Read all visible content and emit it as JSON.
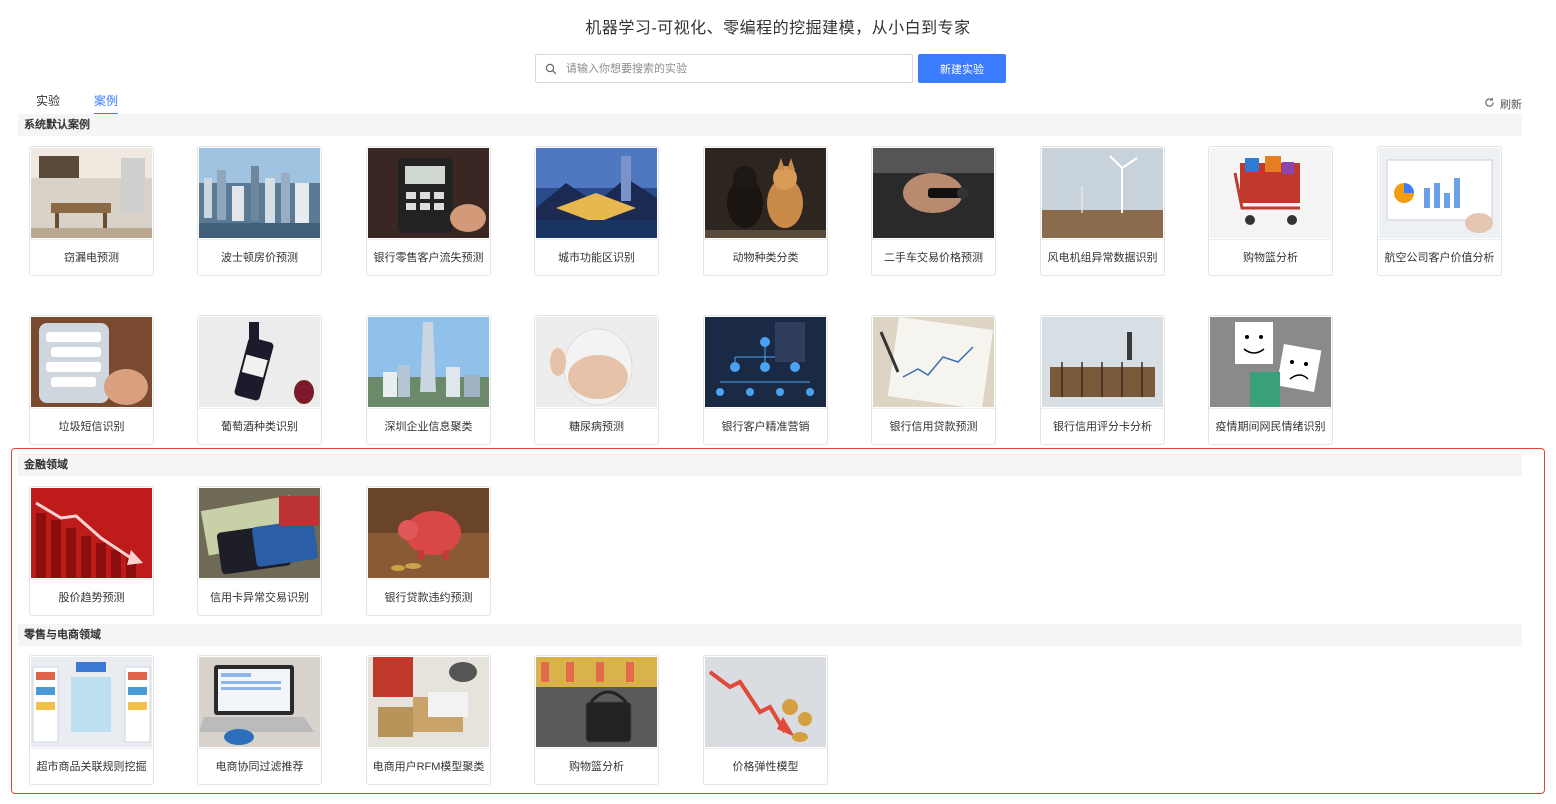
{
  "header": {
    "title": "机器学习-可视化、零编程的挖掘建模，从小白到专家"
  },
  "search": {
    "placeholder": "请输入你想要搜索的实验",
    "value": ""
  },
  "toolbar": {
    "new_button": "新建实验",
    "refresh_label": "刷新"
  },
  "tabs": [
    {
      "label": "实验",
      "active": false
    },
    {
      "label": "案例",
      "active": true
    }
  ],
  "sections": [
    {
      "title": "系统默认案例",
      "cards": [
        {
          "label": "窃漏电预测",
          "icon": "kitchen-photo"
        },
        {
          "label": "波士顿房价预测",
          "icon": "city-skyline-photo"
        },
        {
          "label": "银行零售客户流失预测",
          "icon": "pos-terminal-photo"
        },
        {
          "label": "城市功能区识别",
          "icon": "city-night-photo"
        },
        {
          "label": "动物种类分类",
          "icon": "dogs-photo"
        },
        {
          "label": "二手车交易价格预测",
          "icon": "car-key-photo"
        },
        {
          "label": "风电机组异常数据识别",
          "icon": "wind-turbine-photo"
        },
        {
          "label": "购物篮分析",
          "icon": "shopping-cart-photo"
        },
        {
          "label": "航空公司客户价值分析",
          "icon": "dashboard-photo"
        },
        {
          "label": "垃圾短信识别",
          "icon": "phone-sms-photo"
        },
        {
          "label": "葡萄酒种类识别",
          "icon": "wine-bottle-photo"
        },
        {
          "label": "深圳企业信息聚类",
          "icon": "skyscraper-photo"
        },
        {
          "label": "糖尿病预测",
          "icon": "body-photo"
        },
        {
          "label": "银行客户精准营销",
          "icon": "org-chart-photo"
        },
        {
          "label": "银行信用贷款预测",
          "icon": "document-chart-photo"
        },
        {
          "label": "银行信用评分卡分析",
          "icon": "abacus-photo"
        },
        {
          "label": "疫情期间网民情绪识别",
          "icon": "emotion-faces-photo"
        }
      ]
    },
    {
      "title": "金融领域",
      "cards": [
        {
          "label": "股价趋势预测",
          "icon": "stock-decline-photo"
        },
        {
          "label": "信用卡异常交易识别",
          "icon": "credit-cards-photo"
        },
        {
          "label": "银行贷款违约预测",
          "icon": "piggy-bank-photo"
        }
      ]
    },
    {
      "title": "零售与电商领域",
      "cards": [
        {
          "label": "超市商品关联规则挖掘",
          "icon": "supermarket-photo"
        },
        {
          "label": "电商协同过滤推荐",
          "icon": "laptop-photo"
        },
        {
          "label": "电商用户RFM模型聚类",
          "icon": "packages-photo"
        },
        {
          "label": "购物篮分析",
          "icon": "grocery-basket-photo"
        },
        {
          "label": "价格弹性模型",
          "icon": "price-arrow-photo"
        }
      ]
    }
  ],
  "colors": {
    "accent": "#3b7cff",
    "highlight_border": "#d9483b",
    "section_bg": "#f5f5f5"
  }
}
